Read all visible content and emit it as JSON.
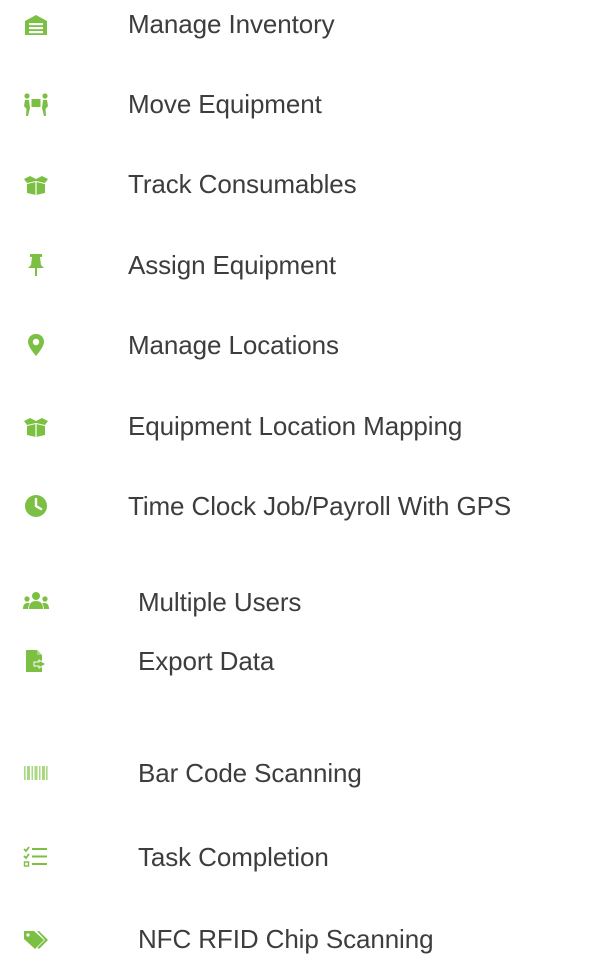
{
  "features": {
    "accent_color": "#7bc043",
    "items": [
      {
        "label": "Manage Inventory",
        "icon": "warehouse-icon"
      },
      {
        "label": "Move Equipment",
        "icon": "people-carry-icon"
      },
      {
        "label": "Track Consumables",
        "icon": "open-box-icon"
      },
      {
        "label": "Assign Equipment",
        "icon": "thumbtack-icon"
      },
      {
        "label": "Manage Locations",
        "icon": "map-marker-icon"
      },
      {
        "label": "Equipment Location Mapping",
        "icon": "open-box-icon"
      },
      {
        "label": "Time Clock Job/Payroll With GPS",
        "icon": "clock-icon"
      },
      {
        "label": "Multiple Users",
        "icon": "users-icon"
      },
      {
        "label": "Export Data",
        "icon": "file-export-icon"
      },
      {
        "label": "Bar Code Scanning",
        "icon": "barcode-icon"
      },
      {
        "label": "Task Completion",
        "icon": "tasks-icon"
      },
      {
        "label": "NFC RFID Chip Scanning",
        "icon": "tags-icon"
      }
    ]
  }
}
